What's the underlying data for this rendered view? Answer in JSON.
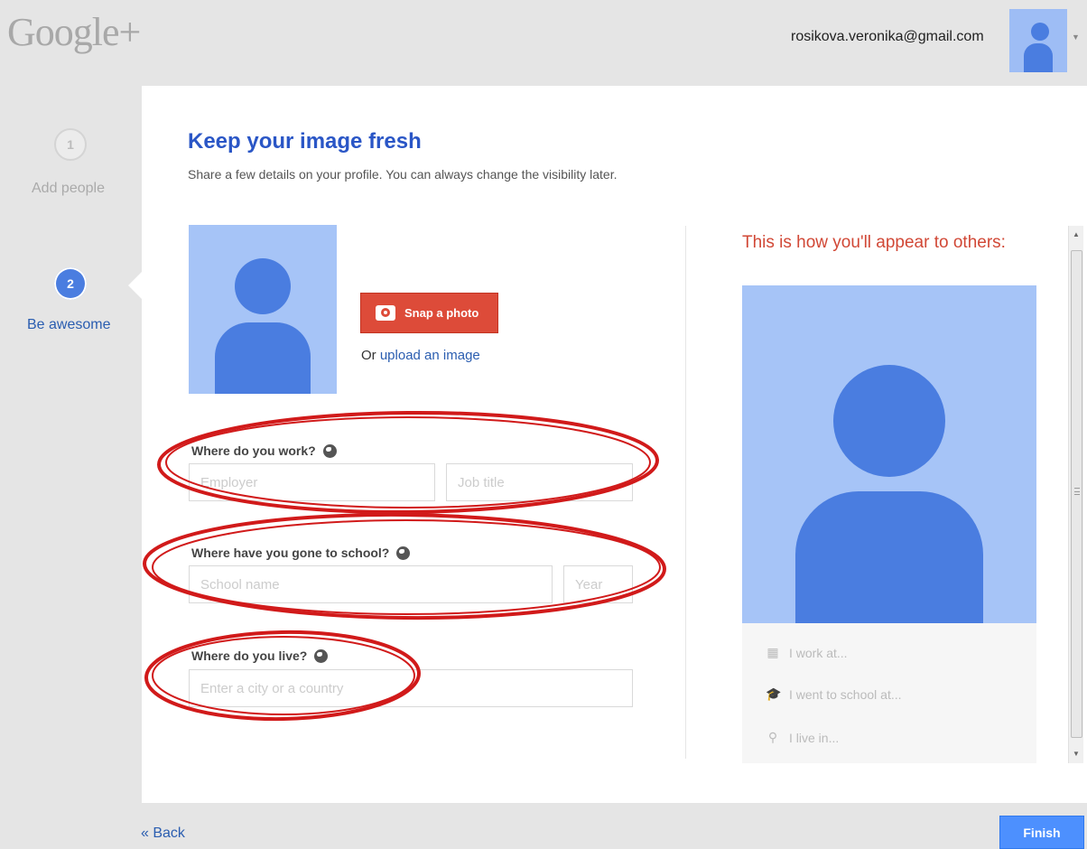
{
  "app": {
    "logo": "Google+"
  },
  "account": {
    "email": "rosikova.veronika@gmail.com",
    "caret": "▼"
  },
  "steps": [
    {
      "number": "1",
      "label": "Add people"
    },
    {
      "number": "2",
      "label": "Be awesome"
    }
  ],
  "main": {
    "title": "Keep your image fresh",
    "subtitle": "Share a few details on your profile. You can always change the visibility later."
  },
  "photo": {
    "snap_label": "Snap a photo",
    "upload_prefix": "Or",
    "upload_link": "upload an image"
  },
  "work": {
    "label": "Where do you work?",
    "employer_placeholder": "Employer",
    "jobtitle_placeholder": "Job title"
  },
  "school": {
    "label": "Where have you gone to school?",
    "school_placeholder": "School name",
    "year_placeholder": "Year"
  },
  "live": {
    "label": "Where do you live?",
    "city_placeholder": "Enter a city or a country"
  },
  "preview": {
    "title": "This is how you'll appear to others:",
    "work": "I work at...",
    "school": "I went to school at...",
    "live": "I live in..."
  },
  "icons": {
    "building": "building-icon",
    "graduation": "graduation-cap-icon",
    "pin": "map-pin-icon",
    "globe": "globe-icon",
    "camera": "camera-icon"
  },
  "colors": {
    "accent_blue": "#4d90fe",
    "title_blue": "#2a56c6",
    "snap_red": "#dd4b39",
    "preview_red": "#d14836",
    "annotation_red": "#d11a1a",
    "avatar_light": "#a6c4f7",
    "avatar_dark": "#4a7de0"
  },
  "footer": {
    "back_label": "« Back",
    "finish_label": "Finish"
  }
}
